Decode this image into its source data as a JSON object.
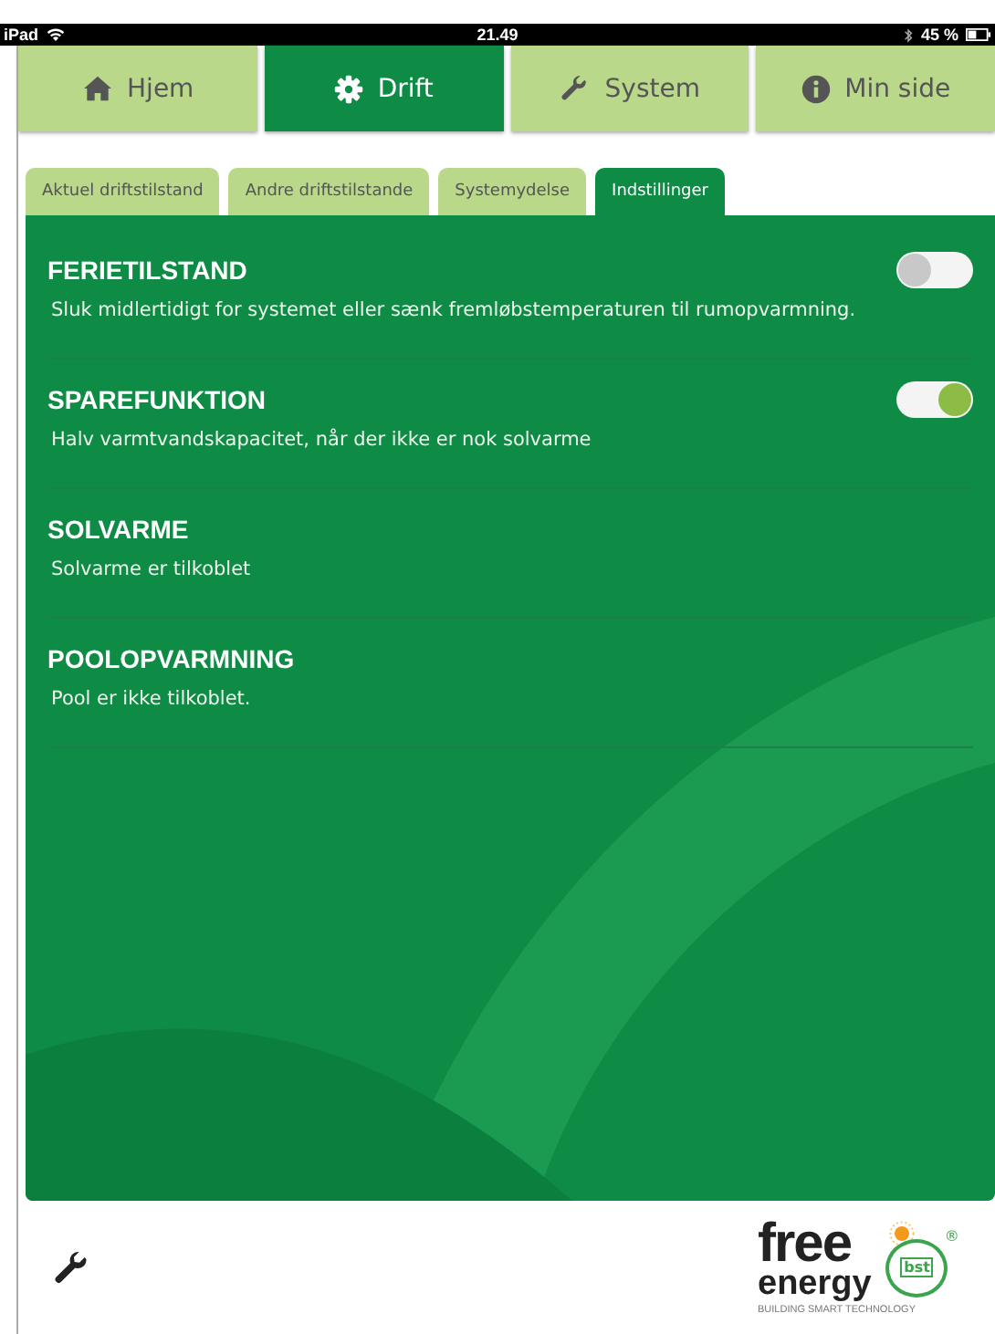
{
  "status_bar": {
    "device": "iPad",
    "time": "21.49",
    "battery": "45 %"
  },
  "main_tabs": [
    {
      "label": "Hjem",
      "kind": "home",
      "selected": false
    },
    {
      "label": "Drift",
      "kind": "gear",
      "selected": true
    },
    {
      "label": "System",
      "kind": "wrench",
      "selected": false
    },
    {
      "label": "Min side",
      "kind": "info",
      "selected": false
    }
  ],
  "sub_tabs": [
    {
      "label": "Aktuel driftstilstand",
      "selected": false
    },
    {
      "label": "Andre driftstilstande",
      "selected": false
    },
    {
      "label": "Systemydelse",
      "selected": false
    },
    {
      "label": "Indstillinger",
      "selected": true
    }
  ],
  "settings": [
    {
      "kind": "toggle",
      "title": "FERIETILSTAND",
      "description": "Sluk midlertidigt for systemet eller sænk fremløbstemperaturen til rumopvarmning.",
      "on": false
    },
    {
      "kind": "toggle",
      "title": "SPAREFUNKTION",
      "description": "Halv varmtvandskapacitet, når der ikke er nok solvarme",
      "on": true
    },
    {
      "kind": "info",
      "title": "SOLVARME",
      "description": "Solvarme er tilkoblet"
    },
    {
      "kind": "info",
      "title": "POOLOPVARMNING",
      "description": "Pool er ikke tilkoblet."
    }
  ],
  "footer": {
    "logo": {
      "word_1": "free",
      "word_2": "energy",
      "badge": "bst",
      "registered": "®",
      "tagline": "BUILDING SMART TECHNOLOGY"
    }
  }
}
